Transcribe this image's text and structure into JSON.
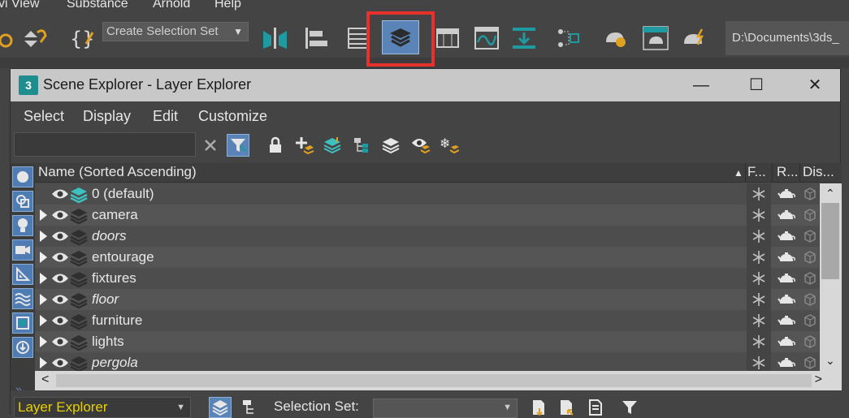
{
  "app_menu": {
    "items": [
      "vi View",
      "Substance",
      "Arnold",
      "Help"
    ]
  },
  "toolbar": {
    "selection_set_placeholder": "Create Selection Set",
    "project_path": "D:\\Documents\\3ds_"
  },
  "window": {
    "title": "Scene Explorer - Layer Explorer",
    "logo_text": "3",
    "minimize": "—",
    "maximize": "☐",
    "close": "✕"
  },
  "explorer_menu": {
    "items": [
      "Select",
      "Display",
      "Edit",
      "Customize"
    ]
  },
  "columns": {
    "name": "Name (Sorted Ascending)",
    "sort_indicator": "▲",
    "frozen": "F...",
    "render": "R...",
    "display": "Dis..."
  },
  "layers": [
    {
      "name": "0 (default)",
      "italic": false,
      "expandable": false,
      "current": true
    },
    {
      "name": "camera",
      "italic": false,
      "expandable": true,
      "current": false
    },
    {
      "name": "doors",
      "italic": true,
      "expandable": true,
      "current": false
    },
    {
      "name": "entourage",
      "italic": false,
      "expandable": true,
      "current": false
    },
    {
      "name": "fixtures",
      "italic": false,
      "expandable": true,
      "current": false
    },
    {
      "name": "floor",
      "italic": true,
      "expandable": true,
      "current": false
    },
    {
      "name": "furniture",
      "italic": false,
      "expandable": true,
      "current": false
    },
    {
      "name": "lights",
      "italic": false,
      "expandable": true,
      "current": false
    },
    {
      "name": "pergola",
      "italic": true,
      "expandable": true,
      "current": false
    }
  ],
  "bottom": {
    "explorer_name": "Layer Explorer",
    "selection_set_label": "Selection Set:",
    "selection_set_value": ""
  },
  "colors": {
    "highlight_red": "#e8312c",
    "active_blue": "#5a84b8",
    "explorer_name_yellow": "#e8d000"
  }
}
